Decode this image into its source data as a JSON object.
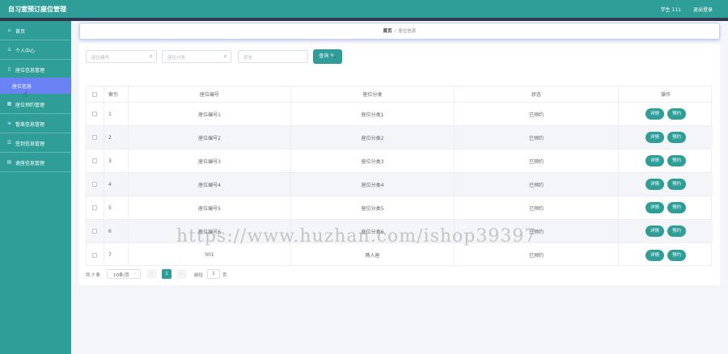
{
  "header": {
    "title": "自习室预订座位管理",
    "user": "学生 111",
    "logout": "退出登录"
  },
  "sidebar": {
    "items": [
      {
        "label": "首页",
        "icon": "home-icon"
      },
      {
        "label": "个人中心",
        "icon": "user-icon"
      },
      {
        "label": "座位信息管理",
        "icon": "document-icon"
      },
      {
        "label": "座位信息",
        "icon": ""
      },
      {
        "label": "座位预约管理",
        "icon": "calendar-icon"
      },
      {
        "label": "暂离信息管理",
        "icon": "pause-icon"
      },
      {
        "label": "签到信息管理",
        "icon": "checkin-icon"
      },
      {
        "label": "退座信息管理",
        "icon": "exit-icon"
      }
    ]
  },
  "breadcrumb": {
    "home": "首页",
    "sep": "/",
    "current": "座位信息"
  },
  "search": {
    "seat_no_placeholder": "座位编号",
    "category_placeholder": "座位分类",
    "status_placeholder": "状态",
    "query_label": "查询 🔍"
  },
  "table": {
    "headers": [
      "索引",
      "座位编号",
      "座位分类",
      "状态",
      "操作"
    ],
    "rows": [
      {
        "idx": "1",
        "seat": "座位编号1",
        "cat": "座位分类1",
        "status": "已预约"
      },
      {
        "idx": "2",
        "seat": "座位编号2",
        "cat": "座位分类2",
        "status": "已预约"
      },
      {
        "idx": "3",
        "seat": "座位编号3",
        "cat": "座位分类3",
        "status": "已预约"
      },
      {
        "idx": "4",
        "seat": "座位编号4",
        "cat": "座位分类4",
        "status": "已预约"
      },
      {
        "idx": "5",
        "seat": "座位编号5",
        "cat": "座位分类5",
        "status": "已预约"
      },
      {
        "idx": "6",
        "seat": "座位编号6",
        "cat": "座位分类6",
        "status": "已预约"
      },
      {
        "idx": "7",
        "seat": "001",
        "cat": "两人座",
        "status": "已预约"
      }
    ],
    "detail_label": "详情",
    "reserve_label": "预约"
  },
  "pagination": {
    "total": "共 7 条",
    "page_size": "10条/页",
    "prev": "‹",
    "current_page": "1",
    "next": "›",
    "goto_prefix": "前往",
    "goto_value": "1",
    "goto_suffix": "页"
  },
  "watermark": "https://www.huzhan.com/ishop39397",
  "colors": {
    "primary": "#2f9e98",
    "active_sub": "#6a82f4",
    "dark_strip": "#2e3a4e"
  }
}
